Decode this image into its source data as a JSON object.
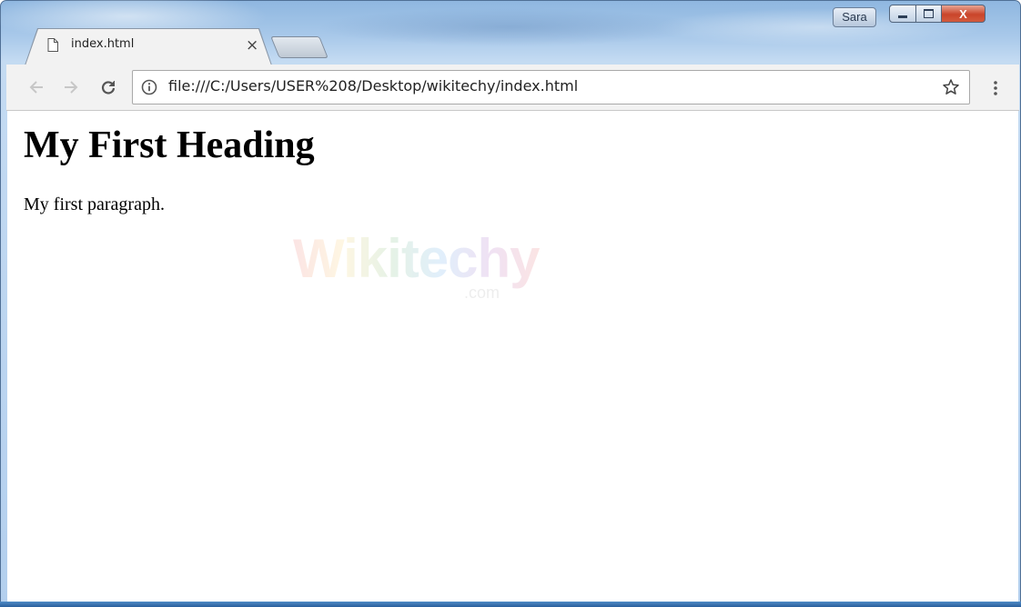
{
  "window": {
    "profile_name": "Sara",
    "controls": {
      "minimize": "–",
      "maximize": "□",
      "close": "X"
    }
  },
  "tab": {
    "title": "index.html",
    "close_glyph": "×",
    "icon": "document-icon"
  },
  "toolbar": {
    "back_icon": "arrow-left-icon",
    "forward_icon": "arrow-right-icon",
    "reload_icon": "reload-icon",
    "info_icon": "info-icon",
    "url": "file:///C:/Users/USER%208/Desktop/wikitechy/index.html",
    "bookmark_icon": "star-icon",
    "menu_icon": "kebab-menu-icon"
  },
  "page": {
    "heading": "My First Heading",
    "paragraph": "My first paragraph.",
    "watermark": {
      "name": "Wikitechy",
      "suffix": ".com"
    }
  },
  "colors": {
    "frame": "#a9c9ea",
    "close_button": "#c9452a",
    "toolbar": "#f2f2f2"
  }
}
